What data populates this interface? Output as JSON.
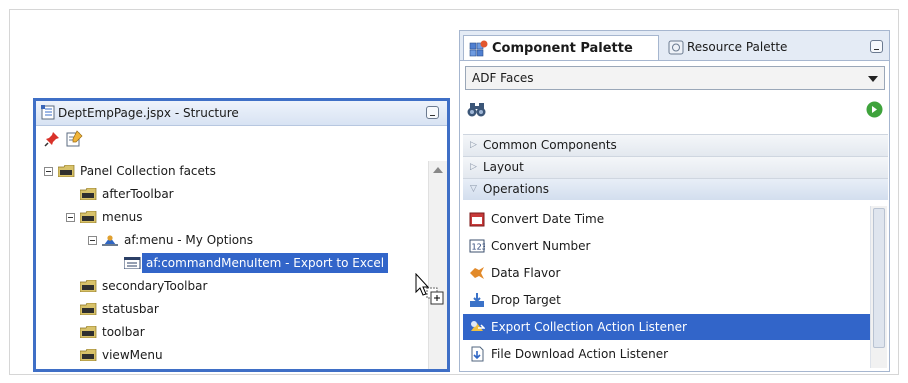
{
  "structure": {
    "title": "DeptEmpPage.jspx - Structure",
    "tree": [
      {
        "label": "Panel Collection facets",
        "indent": 0,
        "expander": true,
        "icon": "folder-icon"
      },
      {
        "label": "afterToolbar",
        "indent": 1,
        "expander": false,
        "icon": "folder-icon"
      },
      {
        "label": "menus",
        "indent": 1,
        "expander": true,
        "icon": "folder-icon"
      },
      {
        "label": "af:menu - My Options",
        "indent": 2,
        "expander": true,
        "icon": "menu-icon"
      },
      {
        "label": "af:commandMenuItem - Export to Excel",
        "indent": 3,
        "expander": false,
        "icon": "menu-item-icon",
        "selected": true
      },
      {
        "label": "secondaryToolbar",
        "indent": 1,
        "expander": false,
        "icon": "folder-icon"
      },
      {
        "label": "statusbar",
        "indent": 1,
        "expander": false,
        "icon": "folder-icon"
      },
      {
        "label": "toolbar",
        "indent": 1,
        "expander": false,
        "icon": "folder-icon"
      },
      {
        "label": "viewMenu",
        "indent": 1,
        "expander": false,
        "icon": "folder-icon"
      }
    ]
  },
  "palette": {
    "tab_active": "Component Palette",
    "tab_inactive": "Resource Palette",
    "library": "ADF Faces",
    "categories": [
      {
        "label": "Common Components",
        "open": false
      },
      {
        "label": "Layout",
        "open": false
      },
      {
        "label": "Operations",
        "open": true
      }
    ],
    "items": [
      {
        "label": "Convert Date Time",
        "icon": "convert-date-icon"
      },
      {
        "label": "Convert Number",
        "icon": "convert-number-icon"
      },
      {
        "label": "Data Flavor",
        "icon": "data-flavor-icon"
      },
      {
        "label": "Drop Target",
        "icon": "drop-target-icon"
      },
      {
        "label": "Export Collection Action Listener",
        "icon": "export-listener-icon",
        "selected": true
      },
      {
        "label": "File Download Action Listener",
        "icon": "file-download-icon"
      }
    ]
  },
  "colors": {
    "selection": "#3265c9",
    "pane_border": "#3f6fc6"
  }
}
